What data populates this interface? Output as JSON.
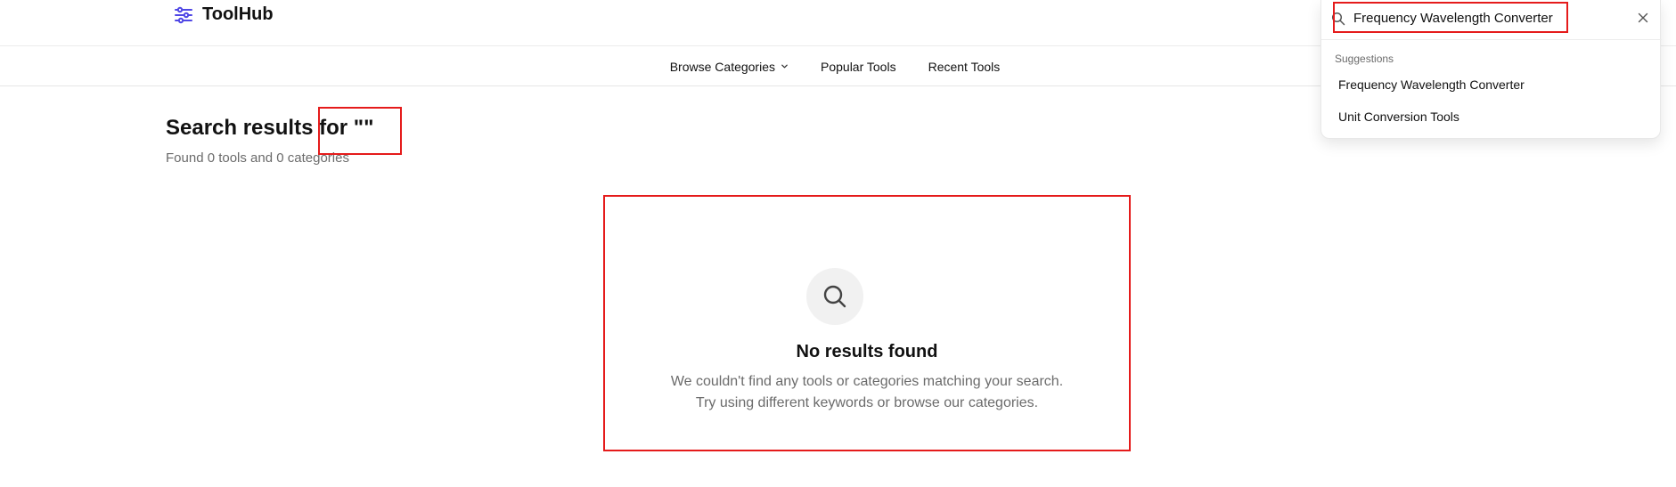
{
  "app": {
    "name": "ToolHub",
    "accent_color": "#4f46e5"
  },
  "nav": {
    "items": [
      {
        "label": "Browse Categories",
        "has_dropdown": true
      },
      {
        "label": "Popular Tools"
      },
      {
        "label": "Recent Tools"
      }
    ]
  },
  "search": {
    "value": "Frequency Wavelength Converter",
    "suggestions_label": "Suggestions",
    "suggestions": [
      "Frequency Wavelength Converter",
      "Unit Conversion Tools"
    ]
  },
  "results": {
    "title": "Search results for \"\"",
    "summary": "Found 0 tools and 0 categories"
  },
  "empty_state": {
    "icon": "search-icon",
    "title": "No results found",
    "line1": "We couldn't find any tools or categories matching your search.",
    "line2": "Try using different keywords or browse our categories."
  },
  "highlight_color": "#e51b1b"
}
